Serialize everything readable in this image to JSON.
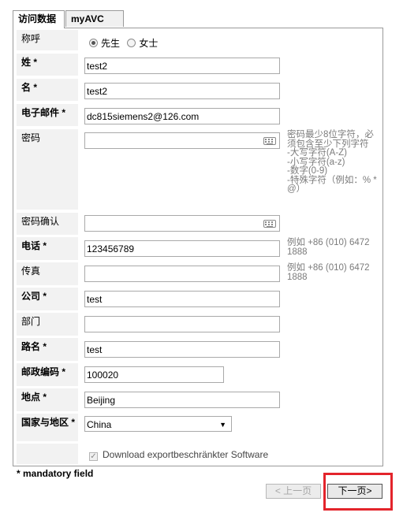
{
  "tabs": [
    {
      "label": "访问数据",
      "active": true
    },
    {
      "label": "myAVC",
      "active": false
    }
  ],
  "form": {
    "salutation": {
      "label": "称呼",
      "options": [
        "先生",
        "女士"
      ],
      "selected": "先生"
    },
    "last_name": {
      "label": "姓 *",
      "value": "test2"
    },
    "first_name": {
      "label": "名 *",
      "value": "test2"
    },
    "email": {
      "label": "电子邮件 *",
      "value": "dc815siemens2@126.com"
    },
    "password": {
      "label": "密码",
      "value": "",
      "hint": "密码最少8位字符，必须包含至少下列字符\n-大写字符(A-Z)\n-小写字符(a-z)\n-数字(0-9)\n-特殊字符（例如：% * @）"
    },
    "password_confirm": {
      "label": "密码确认",
      "value": ""
    },
    "phone": {
      "label": "电话 *",
      "value": "123456789",
      "hint": "例如 +86 (010) 6472 1888"
    },
    "fax": {
      "label": "传真",
      "value": "",
      "hint": "例如 +86 (010) 6472 1888"
    },
    "company": {
      "label": "公司 *",
      "value": "test"
    },
    "department": {
      "label": "部门",
      "value": ""
    },
    "street": {
      "label": "路名 *",
      "value": "test"
    },
    "postal_code": {
      "label": "邮政编码 *",
      "value": "100020"
    },
    "city": {
      "label": "地点 *",
      "value": "Beijing"
    },
    "country": {
      "label": "国家与地区 *",
      "value": "China"
    },
    "export_download": {
      "label": "Download exportbeschränkter Software",
      "checked": true
    }
  },
  "footer": {
    "mandatory_note": "* mandatory field",
    "prev_button": "< 上一页",
    "next_button": "下一页>"
  },
  "colors": {
    "label_bg": "#f2f2f2",
    "hint_text": "#7b7b7b",
    "highlight": "#e3242b"
  },
  "icons": {
    "keyboard": "keyboard-icon",
    "dropdown": "chevron-down-icon"
  }
}
